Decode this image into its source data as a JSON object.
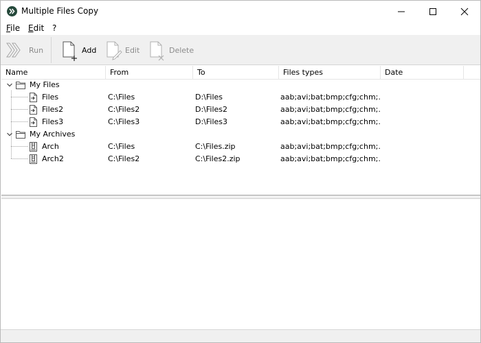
{
  "window": {
    "title": "Multiple Files Copy"
  },
  "menu": {
    "file": {
      "accel": "F",
      "rest": "ile"
    },
    "edit": {
      "accel": "E",
      "rest": "dit"
    },
    "help": "?"
  },
  "toolbar": {
    "run": "Run",
    "add": "Add",
    "edit": "Edit",
    "delete": "Delete"
  },
  "columns": {
    "name": "Name",
    "from": "From",
    "to": "To",
    "types": "Files types",
    "date": "Date"
  },
  "groups": [
    {
      "label": "My Files",
      "items": [
        {
          "name": "Files",
          "from": "C:\\Files",
          "to": "D:\\Files",
          "types": "aab;avi;bat;bmp;cfg;chm;..."
        },
        {
          "name": "Files2",
          "from": "C:\\Files2",
          "to": "D:\\Files2",
          "types": "aab;avi;bat;bmp;cfg;chm;..."
        },
        {
          "name": "Files3",
          "from": "C:\\Files3",
          "to": "D:\\Files3",
          "types": "aab;avi;bat;bmp;cfg;chm;..."
        }
      ]
    },
    {
      "label": "My Archives",
      "items": [
        {
          "name": "Arch",
          "from": "C:\\Files",
          "to": "C:\\Files.zip",
          "types": "aab;avi;bat;bmp;cfg;chm;..."
        },
        {
          "name": "Arch2",
          "from": "C:\\Files2",
          "to": "C:\\Files2.zip",
          "types": "aab;avi;bat;bmp;cfg;chm;..."
        }
      ]
    }
  ],
  "icons": {
    "app": "double-chevron-icon",
    "group": "folder-icon",
    "copy_item": "copy-document-icon",
    "archive_item": "archive-document-icon"
  },
  "colors": {
    "app_icon": "#24483a",
    "toolbar_bg": "#f0f0f0",
    "disabled_text": "#8c8c8c"
  }
}
